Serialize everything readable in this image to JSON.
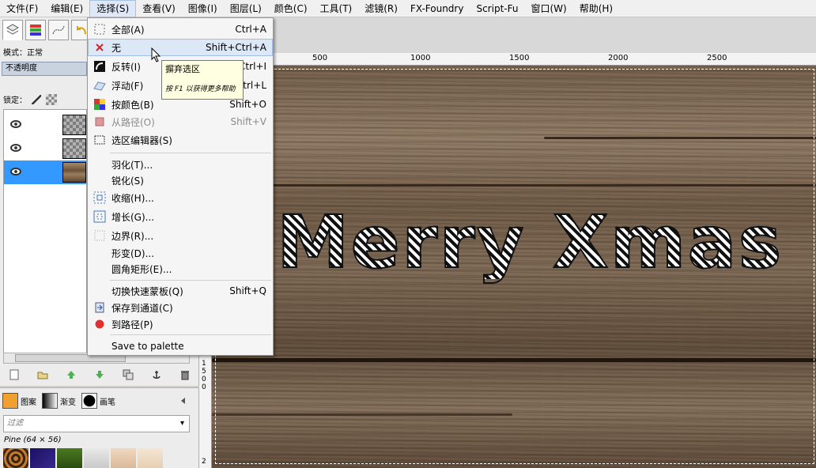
{
  "menubar": {
    "items": [
      {
        "label": "文件(F)"
      },
      {
        "label": "编辑(E)"
      },
      {
        "label": "选择(S)"
      },
      {
        "label": "查看(V)"
      },
      {
        "label": "图像(I)"
      },
      {
        "label": "图层(L)"
      },
      {
        "label": "颜色(C)"
      },
      {
        "label": "工具(T)"
      },
      {
        "label": "滤镜(R)"
      },
      {
        "label": "FX-Foundry"
      },
      {
        "label": "Script-Fu"
      },
      {
        "label": "窗口(W)"
      },
      {
        "label": "帮助(H)"
      }
    ]
  },
  "layers_dock": {
    "mode_label": "模式：正常",
    "opacity_label": "不透明度",
    "lock_label": "锁定："
  },
  "patterns_dock": {
    "tabs": [
      "图案",
      "渐变",
      "画笔"
    ],
    "filter_placeholder": "过滤",
    "pattern_name": "Pine (64 × 56)"
  },
  "ruler": {
    "ticks": [
      "500",
      "1000",
      "1500",
      "2000",
      "2500"
    ],
    "vticks": [
      "1",
      "5",
      "0",
      "0",
      "2"
    ]
  },
  "canvas": {
    "text": "Merry Xmas"
  },
  "select_menu": {
    "items": [
      {
        "label": "全部(A)",
        "shortcut": "Ctrl+A"
      },
      {
        "label": "无",
        "shortcut": "Shift+Ctrl+A"
      },
      {
        "label": "反转(I)",
        "shortcut": "Ctrl+I"
      },
      {
        "label": "浮动(F)",
        "shortcut": "Shift+Ctrl+L"
      },
      {
        "label": "按颜色(B)",
        "shortcut": "Shift+O"
      },
      {
        "label": "从路径(O)",
        "shortcut": "Shift+V"
      },
      {
        "label": "选区编辑器(S)",
        "shortcut": ""
      },
      {
        "label": "羽化(T)...",
        "shortcut": ""
      },
      {
        "label": "锐化(S)",
        "shortcut": ""
      },
      {
        "label": "收缩(H)...",
        "shortcut": ""
      },
      {
        "label": "增长(G)...",
        "shortcut": ""
      },
      {
        "label": "边界(R)...",
        "shortcut": ""
      },
      {
        "label": "形变(D)...",
        "shortcut": ""
      },
      {
        "label": "圆角矩形(E)...",
        "shortcut": ""
      },
      {
        "label": "切换快速蒙板(Q)",
        "shortcut": "Shift+Q"
      },
      {
        "label": "保存到通道(C)",
        "shortcut": ""
      },
      {
        "label": "到路径(P)",
        "shortcut": ""
      },
      {
        "label": "Save to palette",
        "shortcut": ""
      }
    ]
  },
  "tooltip": {
    "title": "摒弃选区",
    "hint": "按 F1 以获得更多帮助"
  }
}
